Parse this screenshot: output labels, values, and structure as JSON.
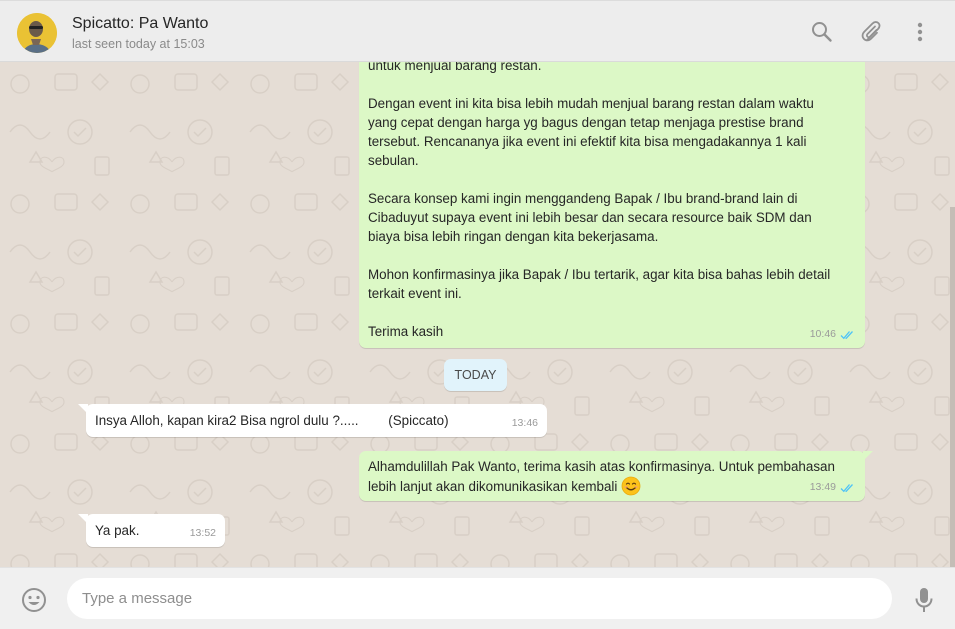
{
  "header": {
    "contact_name": "Spicatto: Pa Wanto",
    "last_seen": "last seen today at 15:03",
    "icons": [
      "search-icon",
      "attach-icon",
      "menu-icon"
    ]
  },
  "messages": {
    "m1": {
      "direction": "outgoing",
      "lines": [
        "untuk menjual barang restan.",
        "",
        "Dengan event ini kita bisa lebih mudah menjual barang restan dalam waktu",
        "yang cepat dengan harga yg bagus dengan tetap menjaga prestise brand",
        "tersebut. Rencananya jika event ini efektif kita bisa mengadakannya 1 kali",
        "sebulan.",
        "",
        "Secara konsep kami ingin menggandeng Bapak / Ibu brand-brand lain di",
        "Cibaduyut supaya event ini lebih besar dan secara resource baik SDM dan",
        "biaya bisa lebih ringan dengan kita bekerjasama.",
        "",
        "Mohon konfirmasinya jika Bapak / Ibu tertarik, agar kita bisa bahas lebih detail",
        "terkait event ini.",
        "",
        "Terima kasih"
      ],
      "time": "10:46",
      "status": "read"
    },
    "date_divider": "TODAY",
    "m2": {
      "direction": "incoming",
      "text": "Insya Alloh, kapan kira2 Bisa ngrol dulu ?.....        (Spiccato)",
      "time": "13:46"
    },
    "m3": {
      "direction": "outgoing",
      "line1": "Alhamdulillah Pak Wanto, terima kasih atas konfirmasinya. Untuk pembahasan",
      "line2": "lebih lanjut akan dikomunikasikan kembali",
      "emoji": "smiling-face-emoji",
      "time": "13:49",
      "status": "read"
    },
    "m4": {
      "direction": "incoming",
      "text": "Ya pak.",
      "time": "13:52"
    }
  },
  "composer": {
    "placeholder": "Type a message",
    "value": "",
    "icons": [
      "emoji-icon",
      "mic-icon"
    ]
  },
  "colors": {
    "outgoing_bubble": "#dcf8c6",
    "incoming_bubble": "#ffffff",
    "chat_background": "#e5ddd5",
    "read_ticks": "#4fc3f7",
    "date_chip": "#e1f3fb"
  }
}
